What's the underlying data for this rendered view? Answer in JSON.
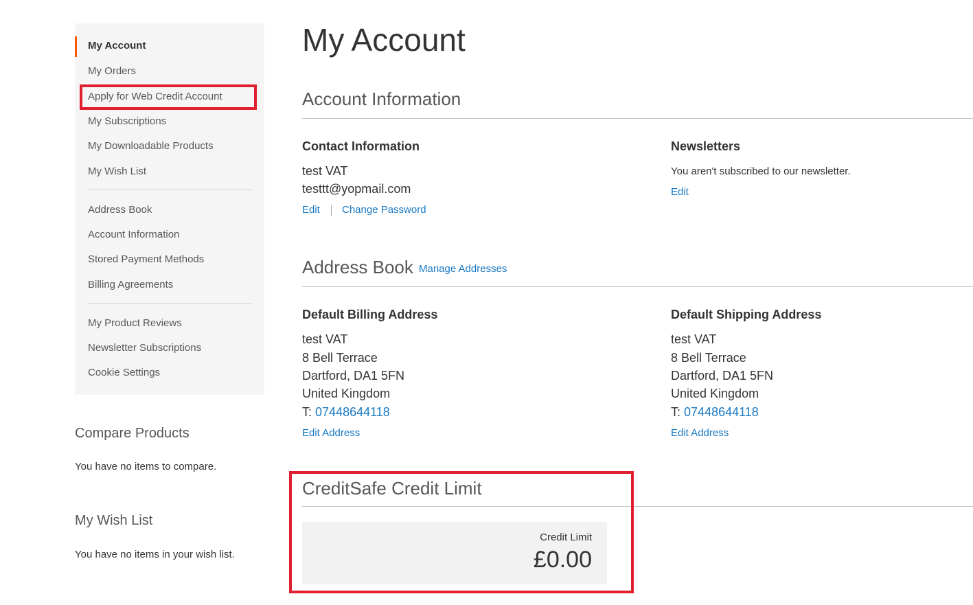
{
  "sidebar": {
    "items": [
      {
        "label": "My Account",
        "current": true
      },
      {
        "label": "My Orders"
      },
      {
        "label": "Apply for Web Credit Account"
      },
      {
        "label": "My Subscriptions"
      },
      {
        "label": "My Downloadable Products"
      },
      {
        "label": "My Wish List"
      },
      {
        "label": "Address Book"
      },
      {
        "label": "Account Information"
      },
      {
        "label": "Stored Payment Methods"
      },
      {
        "label": "Billing Agreements"
      },
      {
        "label": "My Product Reviews"
      },
      {
        "label": "Newsletter Subscriptions"
      },
      {
        "label": "Cookie Settings"
      }
    ]
  },
  "compare": {
    "title": "Compare Products",
    "empty_text": "You have no items to compare."
  },
  "wishlist": {
    "title": "My Wish List",
    "empty_text": "You have no items in your wish list."
  },
  "main": {
    "page_title": "My Account",
    "account_info": {
      "title": "Account Information",
      "contact": {
        "title": "Contact Information",
        "name": "test VAT",
        "email": "testtt@yopmail.com",
        "edit_label": "Edit",
        "change_password_label": "Change Password"
      },
      "newsletters": {
        "title": "Newsletters",
        "text": "You aren't subscribed to our newsletter.",
        "edit_label": "Edit"
      }
    },
    "address_book": {
      "title": "Address Book",
      "manage_label": "Manage Addresses",
      "billing": {
        "title": "Default Billing Address",
        "name": "test VAT",
        "street": "8 Bell Terrace",
        "city": "Dartford, DA1 5FN",
        "country": "United Kingdom",
        "phone_prefix": "T:",
        "phone": "07448644118",
        "edit_label": "Edit Address"
      },
      "shipping": {
        "title": "Default Shipping Address",
        "name": "test VAT",
        "street": "8 Bell Terrace",
        "city": "Dartford, DA1 5FN",
        "country": "United Kingdom",
        "phone_prefix": "T:",
        "phone": "07448644118",
        "edit_label": "Edit Address"
      }
    },
    "credit": {
      "title": "CreditSafe Credit Limit",
      "label": "Credit Limit",
      "value": "£0.00"
    }
  },
  "colors": {
    "accent": "#ff5501",
    "link": "#1979c3",
    "highlight": "#e02030"
  }
}
